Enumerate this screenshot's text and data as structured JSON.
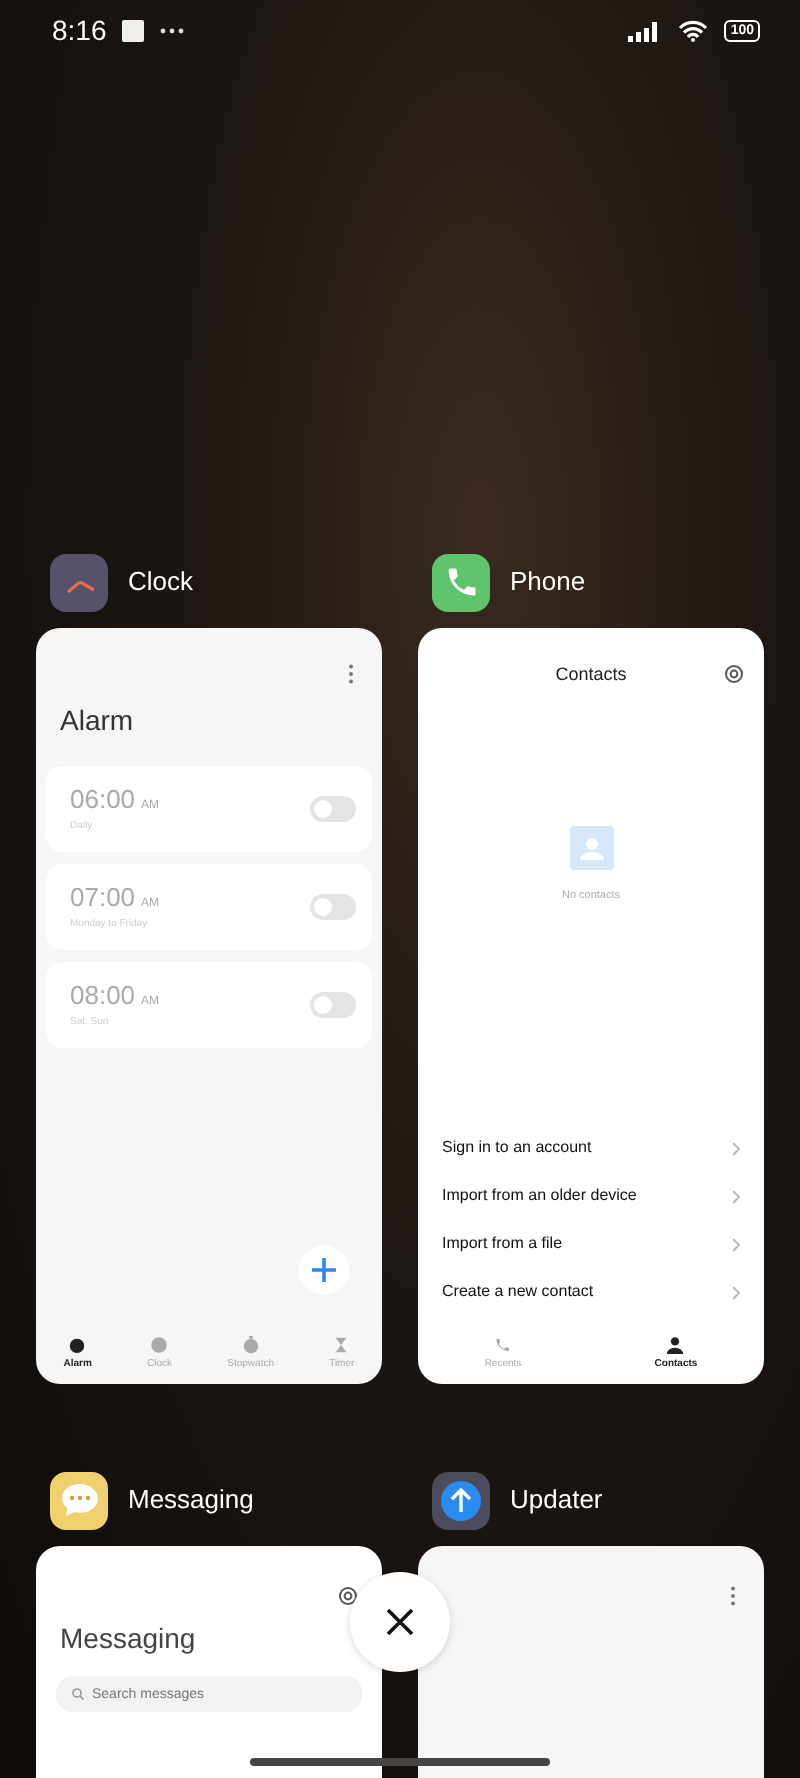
{
  "status_bar": {
    "time": "8:16",
    "battery": "100"
  },
  "apps": [
    {
      "name": "Clock",
      "kind": "clock",
      "screen": {
        "title": "Alarm",
        "alarms": [
          {
            "time": "06:00",
            "period": "AM",
            "repeat": "Daily",
            "on": false
          },
          {
            "time": "07:00",
            "period": "AM",
            "repeat": "Monday to Friday",
            "on": false
          },
          {
            "time": "08:00",
            "period": "AM",
            "repeat": "Sat, Sun",
            "on": false
          }
        ],
        "tabs": [
          {
            "label": "Alarm",
            "selected": true
          },
          {
            "label": "Clock",
            "selected": false
          },
          {
            "label": "Stopwatch",
            "selected": false
          },
          {
            "label": "Timer",
            "selected": false
          }
        ]
      }
    },
    {
      "name": "Phone",
      "kind": "phone",
      "screen": {
        "title": "Contacts",
        "empty_text": "No contacts",
        "actions": [
          "Sign in to an account",
          "Import from an older device",
          "Import from a file",
          "Create a new contact"
        ],
        "tabs": [
          {
            "label": "Recents",
            "selected": false
          },
          {
            "label": "Contacts",
            "selected": true
          }
        ]
      }
    },
    {
      "name": "Messaging",
      "kind": "messaging",
      "screen": {
        "title": "Messaging",
        "search_placeholder": "Search messages"
      }
    },
    {
      "name": "Updater",
      "kind": "updater"
    }
  ]
}
